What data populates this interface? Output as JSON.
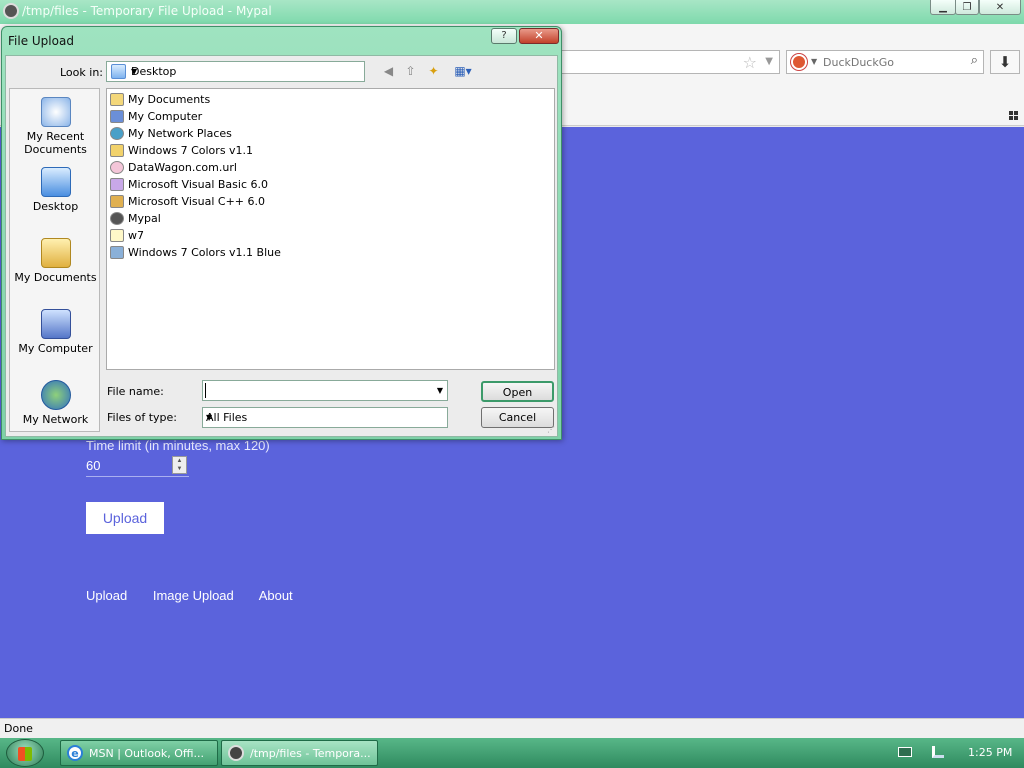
{
  "window": {
    "title": "/tmp/files - Temporary File Upload - Mypal",
    "controls": {
      "minimize": "▁",
      "restore": "❐",
      "close": "✕"
    }
  },
  "toolbar": {
    "search_placeholder": "DuckDuckGo"
  },
  "page": {
    "time_limit_label": "Time limit (in minutes, max 120)",
    "time_limit_value": "60",
    "upload_button": "Upload",
    "footer_links": [
      "Upload",
      "Image Upload",
      "About"
    ],
    "background_color": "#5b63dc"
  },
  "status_bar": {
    "text": "Done"
  },
  "taskbar": {
    "buttons": [
      {
        "label": "MSN | Outlook, Offi...",
        "icon": "ie-icon"
      },
      {
        "label": "/tmp/files - Tempora...",
        "icon": "mypal-icon",
        "active": true
      }
    ],
    "clock": "1:25 PM"
  },
  "dialog": {
    "title": "File Upload",
    "help": "?",
    "close": "✕",
    "look_in_label": "Look in:",
    "look_in_value": "Desktop",
    "places": [
      {
        "label": "My Recent Documents",
        "icon": "recent-documents-icon"
      },
      {
        "label": "Desktop",
        "icon": "desktop-icon"
      },
      {
        "label": "My Documents",
        "icon": "my-documents-icon"
      },
      {
        "label": "My Computer",
        "icon": "my-computer-icon"
      },
      {
        "label": "My Network",
        "icon": "my-network-icon"
      }
    ],
    "files": [
      {
        "name": "My Documents",
        "icon": "my-documents-icon"
      },
      {
        "name": "My Computer",
        "icon": "my-computer-icon"
      },
      {
        "name": "My Network Places",
        "icon": "network-places-icon"
      },
      {
        "name": "Windows 7 Colors v1.1",
        "icon": "folder-icon"
      },
      {
        "name": "DataWagon.com.url",
        "icon": "url-icon"
      },
      {
        "name": "Microsoft Visual Basic 6.0",
        "icon": "vb-icon"
      },
      {
        "name": "Microsoft Visual C++ 6.0",
        "icon": "vc-icon"
      },
      {
        "name": "Mypal",
        "icon": "mypal-icon"
      },
      {
        "name": "w7",
        "icon": "text-file-icon"
      },
      {
        "name": "Windows 7 Colors v1.1 Blue",
        "icon": "theme-icon"
      }
    ],
    "file_name_label": "File name:",
    "file_name_value": "",
    "files_of_type_label": "Files of type:",
    "files_of_type_value": "All Files",
    "open_button": "Open",
    "cancel_button": "Cancel"
  }
}
